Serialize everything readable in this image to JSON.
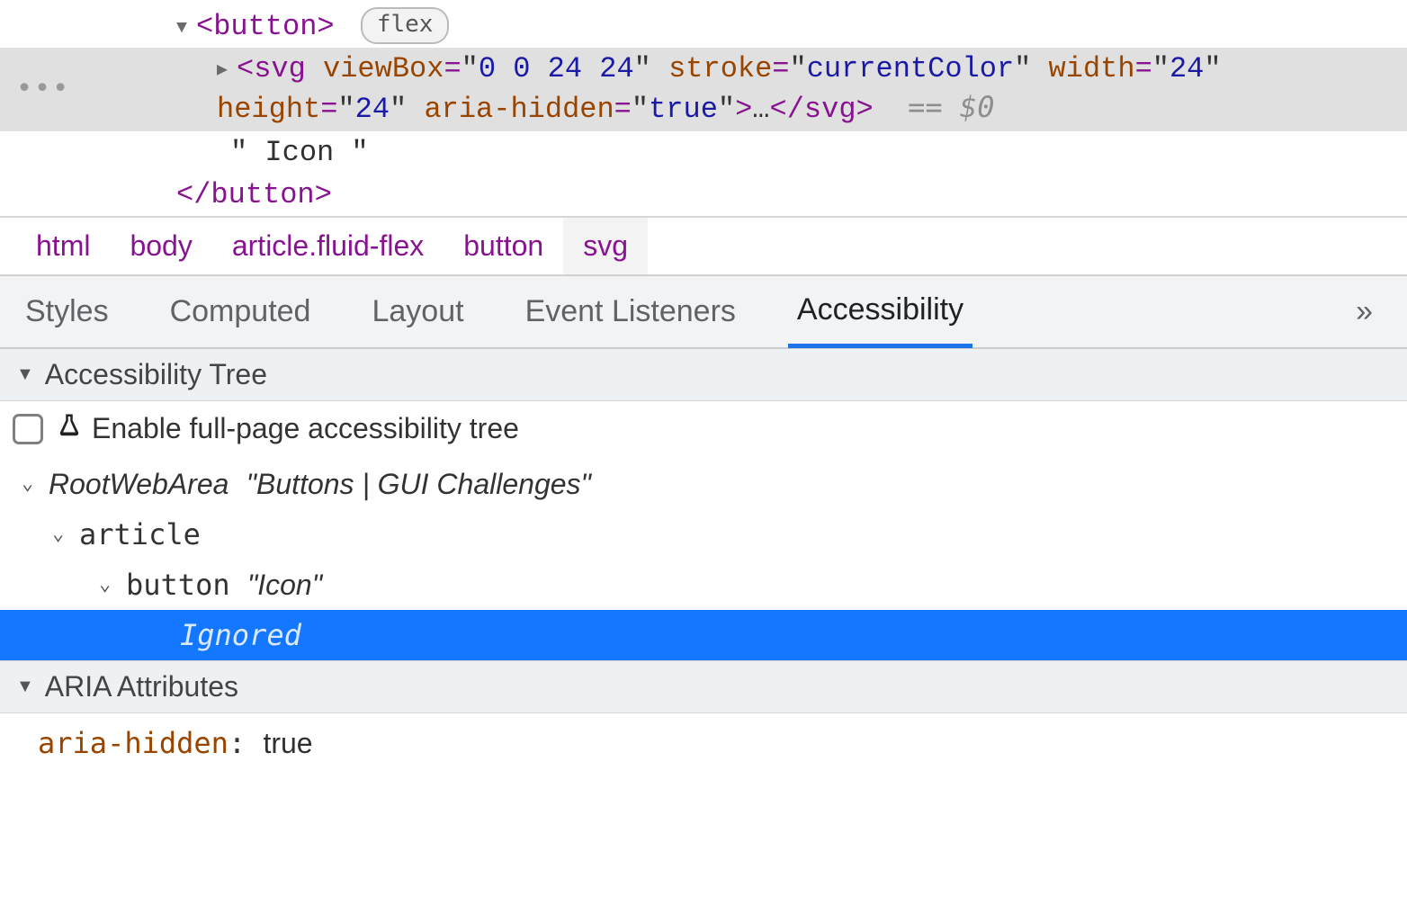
{
  "dom": {
    "button_open": "<button>",
    "flex_badge": "flex",
    "svg_segments": {
      "tag_open": "<svg",
      "attr1_name": "viewBox",
      "attr1_val": "0 0 24 24",
      "attr2_name": "stroke",
      "attr2_val": "currentColor",
      "attr3_name": "width",
      "attr3_val": "24",
      "attr4_name": "height",
      "attr4_val": "24",
      "attr5_name": "aria-hidden",
      "attr5_val": "true",
      "tag_close": ">",
      "ellipsis": "…",
      "close": "</svg>",
      "eq0": "== $0"
    },
    "text_node": "\" Icon \"",
    "button_close": "</button>"
  },
  "breadcrumb": {
    "items": [
      "html",
      "body",
      "article.fluid-flex",
      "button",
      "svg"
    ],
    "active_index": 4
  },
  "tabs": {
    "items": [
      "Styles",
      "Computed",
      "Layout",
      "Event Listeners",
      "Accessibility"
    ],
    "active_index": 4,
    "more": "»"
  },
  "sections": {
    "a11y_tree_header": "Accessibility Tree",
    "enable_full_tree": "Enable full-page accessibility tree",
    "aria_attrs_header": "ARIA Attributes"
  },
  "a11y_tree": {
    "root_role": "RootWebArea",
    "root_name": "\"Buttons | GUI Challenges\"",
    "article_role": "article",
    "button_role": "button",
    "button_name": "\"Icon\"",
    "ignored": "Ignored"
  },
  "aria_attrs": {
    "key": "aria-hidden",
    "value": "true"
  }
}
